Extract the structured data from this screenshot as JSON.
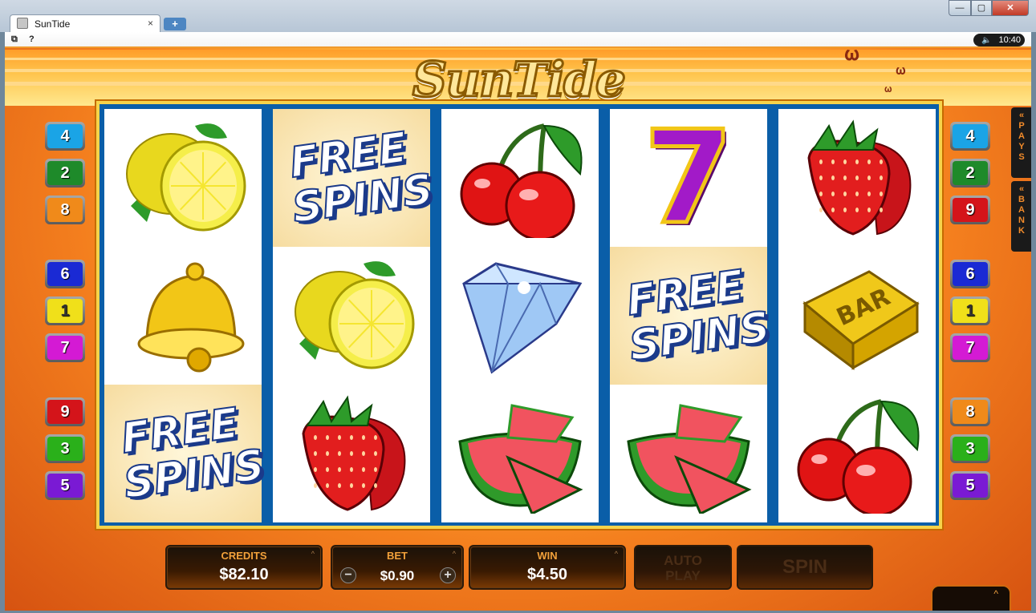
{
  "window": {
    "tab_title": "SunTide",
    "tab_close": "×",
    "new_tab": "+",
    "min": "—",
    "max": "▢",
    "close": "✕"
  },
  "topbar": {
    "menu_icon": "⧉",
    "help": "?",
    "speaker_icon": "speaker-icon",
    "time": "10:40"
  },
  "game": {
    "logo": "SunTide",
    "reels": [
      [
        "lemon",
        "bell",
        "free-spins"
      ],
      [
        "free-spins",
        "lemon",
        "strawberry"
      ],
      [
        "cherry",
        "diamond",
        "watermelon"
      ],
      [
        "seven",
        "free-spins",
        "watermelon"
      ],
      [
        "strawberry",
        "bar",
        "cherry"
      ]
    ],
    "free_spins_text": [
      "FREE",
      "SPINS"
    ],
    "bar_text": "BAR",
    "seven_text": "7",
    "paylines_left": [
      {
        "n": "4",
        "color": "#1aa4e6"
      },
      {
        "n": "2",
        "color": "#1e8a2a"
      },
      {
        "n": "8",
        "color": "#f08a1a"
      },
      {
        "n": "6",
        "color": "#1a2ad4"
      },
      {
        "n": "1",
        "color": "#f0e01a"
      },
      {
        "n": "7",
        "color": "#d41ad4"
      },
      {
        "n": "9",
        "color": "#d4141a"
      },
      {
        "n": "3",
        "color": "#2ab01a"
      },
      {
        "n": "5",
        "color": "#7a1ad4"
      }
    ],
    "paylines_right": [
      {
        "n": "4",
        "color": "#1aa4e6"
      },
      {
        "n": "2",
        "color": "#1e8a2a"
      },
      {
        "n": "9",
        "color": "#d4141a"
      },
      {
        "n": "6",
        "color": "#1a2ad4"
      },
      {
        "n": "1",
        "color": "#f0e01a"
      },
      {
        "n": "7",
        "color": "#d41ad4"
      },
      {
        "n": "8",
        "color": "#f08a1a"
      },
      {
        "n": "3",
        "color": "#2ab01a"
      },
      {
        "n": "5",
        "color": "#7a1ad4"
      }
    ],
    "side_tabs": {
      "pays": "«\nP\nA\nY\nS",
      "bank": "«\nB\nA\nN\nK"
    }
  },
  "console": {
    "credits_label": "CREDITS",
    "credits_value": "$82.10",
    "bet_label": "BET",
    "bet_value": "$0.90",
    "bet_minus": "−",
    "bet_plus": "+",
    "win_label": "WIN",
    "win_value": "$4.50",
    "autoplay_label": "AUTO\nPLAY",
    "spin_label": "SPIN",
    "expand": "^"
  }
}
